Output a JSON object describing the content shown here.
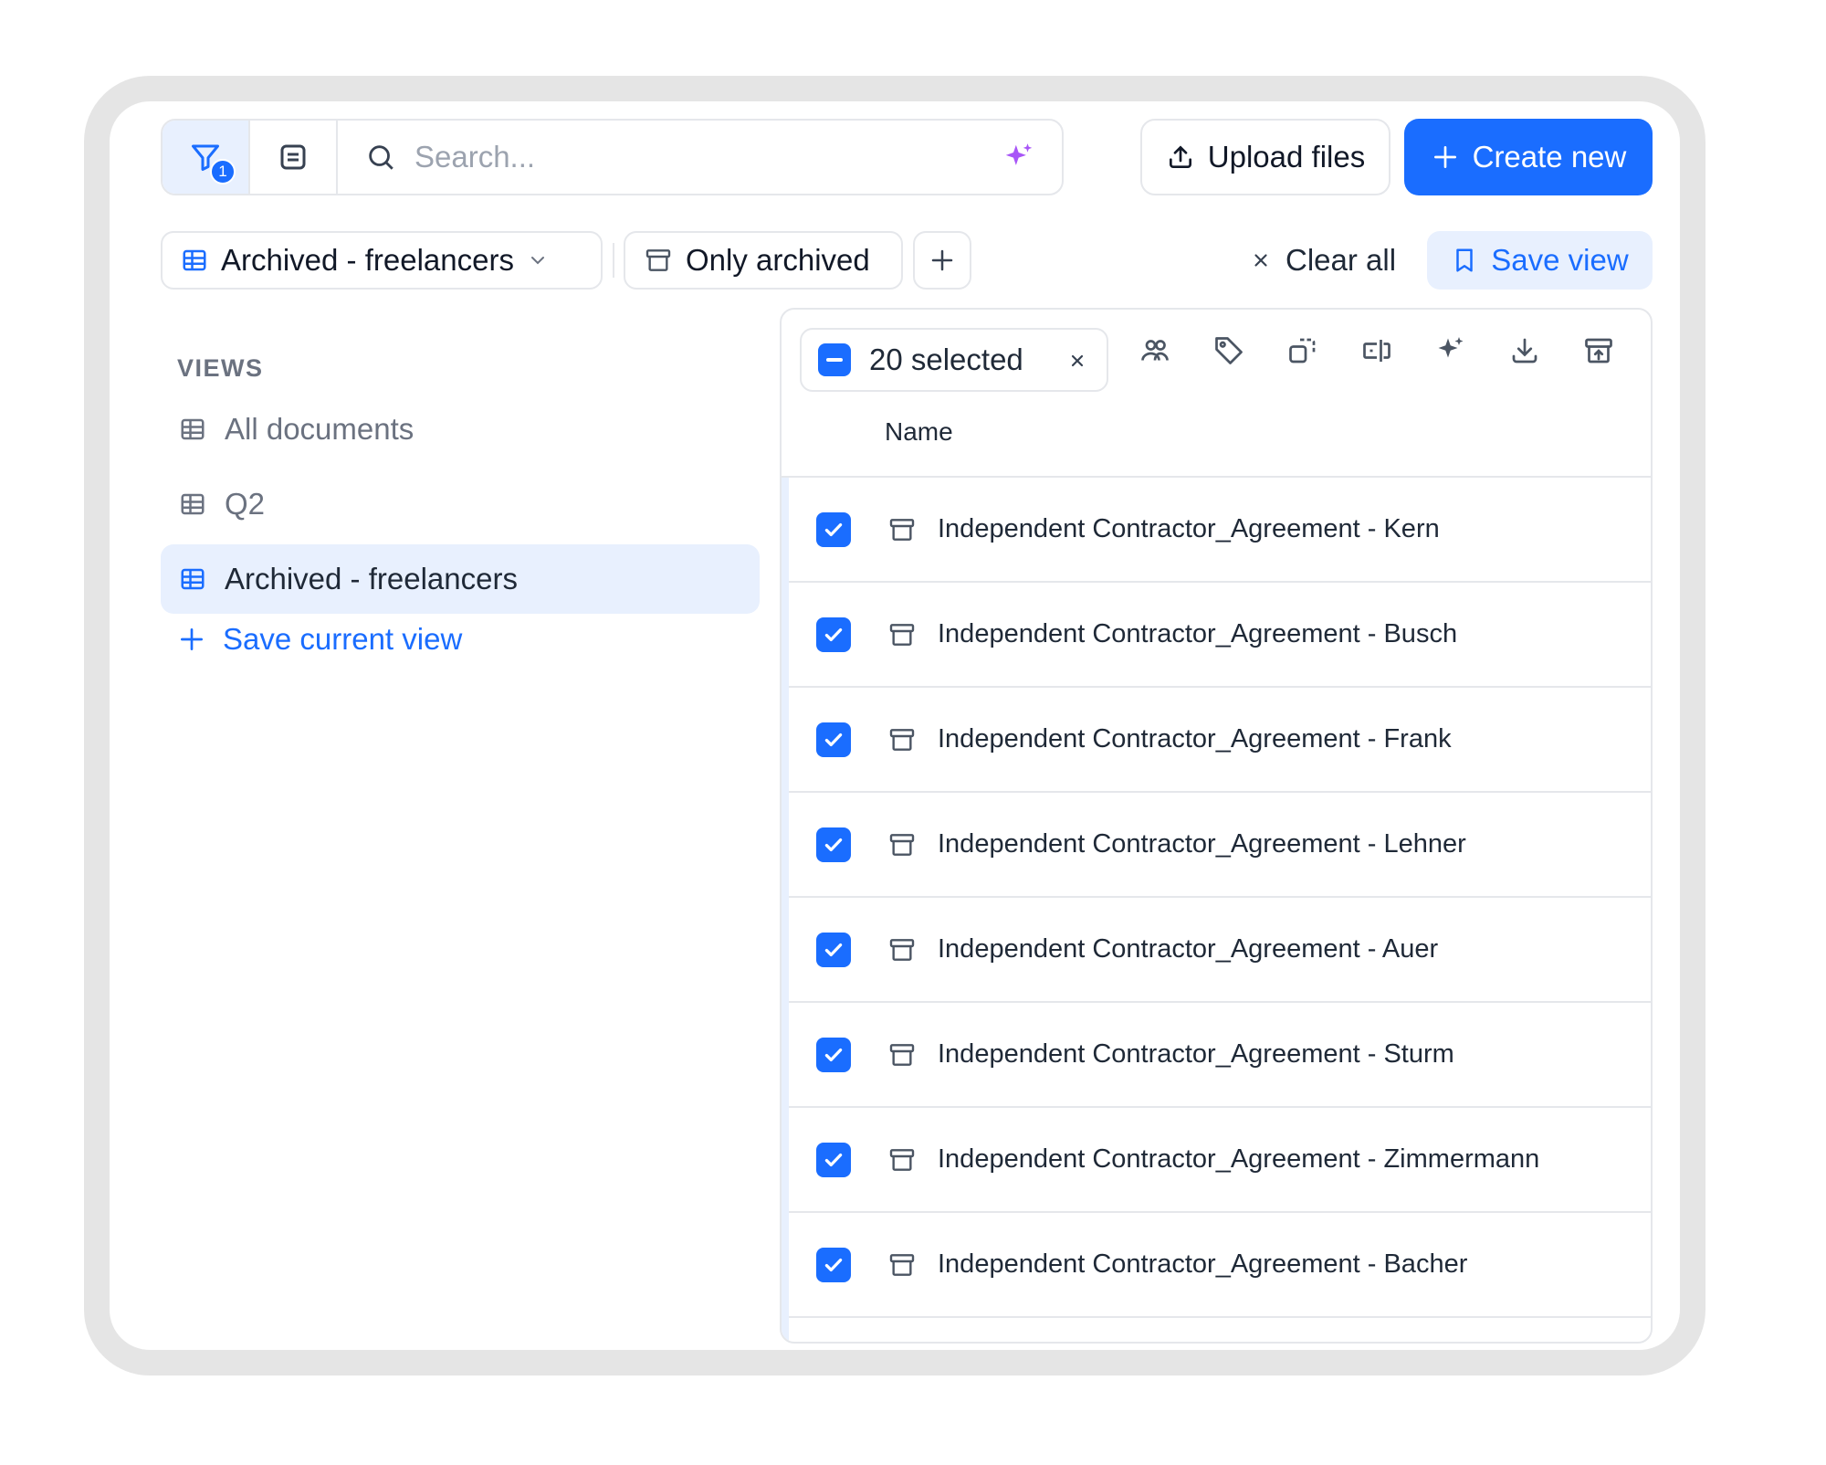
{
  "toolbar": {
    "filter_badge": "1",
    "search_placeholder": "Search...",
    "upload_label": "Upload files",
    "create_label": "Create new"
  },
  "filters": {
    "view_chip": "Archived - freelancers",
    "archived_chip": "Only archived",
    "clear_all": "Clear all",
    "save_view": "Save view"
  },
  "sidebar": {
    "heading": "VIEWS",
    "items": [
      {
        "label": "All documents",
        "selected": false
      },
      {
        "label": "Q2",
        "selected": false
      },
      {
        "label": "Archived - freelancers",
        "selected": true
      }
    ],
    "save_current": "Save current view"
  },
  "table": {
    "selected_label": "20 selected",
    "column_name": "Name",
    "action_icons": [
      "users-icon",
      "tag-icon",
      "copy-icon",
      "rename-icon",
      "sparkle-icon",
      "download-icon",
      "archive-icon"
    ],
    "rows": [
      {
        "name": "Independent Contractor_Agreement - Kern",
        "checked": true
      },
      {
        "name": "Independent Contractor_Agreement - Busch",
        "checked": true
      },
      {
        "name": "Independent Contractor_Agreement - Frank",
        "checked": true
      },
      {
        "name": "Independent Contractor_Agreement - Lehner",
        "checked": true
      },
      {
        "name": "Independent Contractor_Agreement - Auer",
        "checked": true
      },
      {
        "name": "Independent Contractor_Agreement - Sturm",
        "checked": true
      },
      {
        "name": "Independent Contractor_Agreement - Zimmermann",
        "checked": true
      },
      {
        "name": "Independent Contractor_Agreement - Bacher",
        "checked": true
      }
    ]
  },
  "colors": {
    "accent": "#1a6dff",
    "accent_light": "#e8f0fe",
    "sparkle": "#a855f7",
    "border": "#e5e7eb",
    "frame": "#e5e5e5"
  }
}
